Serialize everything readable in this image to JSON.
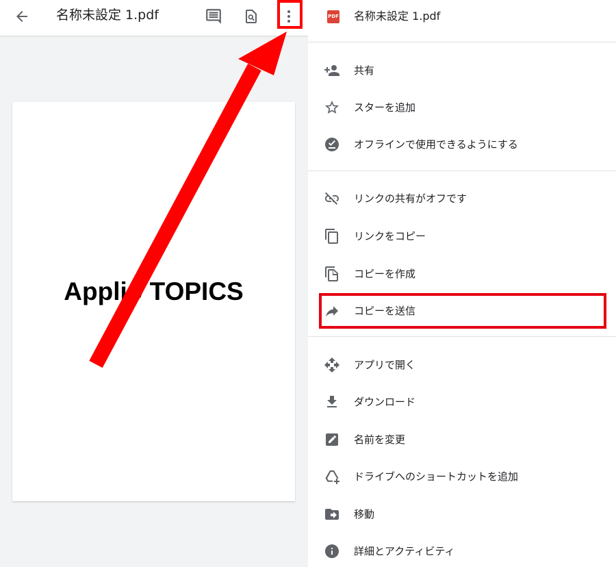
{
  "viewer": {
    "title": "名称未設定 1.pdf",
    "page_text": "Applio TOPICS",
    "icons": [
      "arrow-back-icon",
      "comment-icon",
      "find-in-page-icon",
      "more-vert-icon"
    ]
  },
  "menu": {
    "header": {
      "badge": "PDF",
      "title": "名称未設定 1.pdf"
    },
    "items": [
      {
        "label": "共有",
        "icon": "person-add-icon"
      },
      {
        "label": "スターを追加",
        "icon": "star-outline-icon"
      },
      {
        "label": "オフラインで使用できるようにする",
        "icon": "offline-pin-icon"
      },
      {
        "label": "リンクの共有がオフです",
        "icon": "link-off-icon"
      },
      {
        "label": "リンクをコピー",
        "icon": "copy-link-icon"
      },
      {
        "label": "コピーを作成",
        "icon": "file-copy-icon"
      },
      {
        "label": "コピーを送信",
        "icon": "forward-arrow-icon"
      },
      {
        "label": "アプリで開く",
        "icon": "open-with-icon"
      },
      {
        "label": "ダウンロード",
        "icon": "download-icon"
      },
      {
        "label": "名前を変更",
        "icon": "rename-icon"
      },
      {
        "label": "ドライブへのショートカットを追加",
        "icon": "add-to-drive-icon"
      },
      {
        "label": "移動",
        "icon": "move-folder-icon"
      },
      {
        "label": "詳細とアクティビティ",
        "icon": "info-icon"
      }
    ]
  },
  "colors": {
    "annotation_red": "#ff0000",
    "icon_gray": "#5f6368",
    "viewer_bg": "#f1f3f4",
    "pdf_badge": "#db4437"
  }
}
